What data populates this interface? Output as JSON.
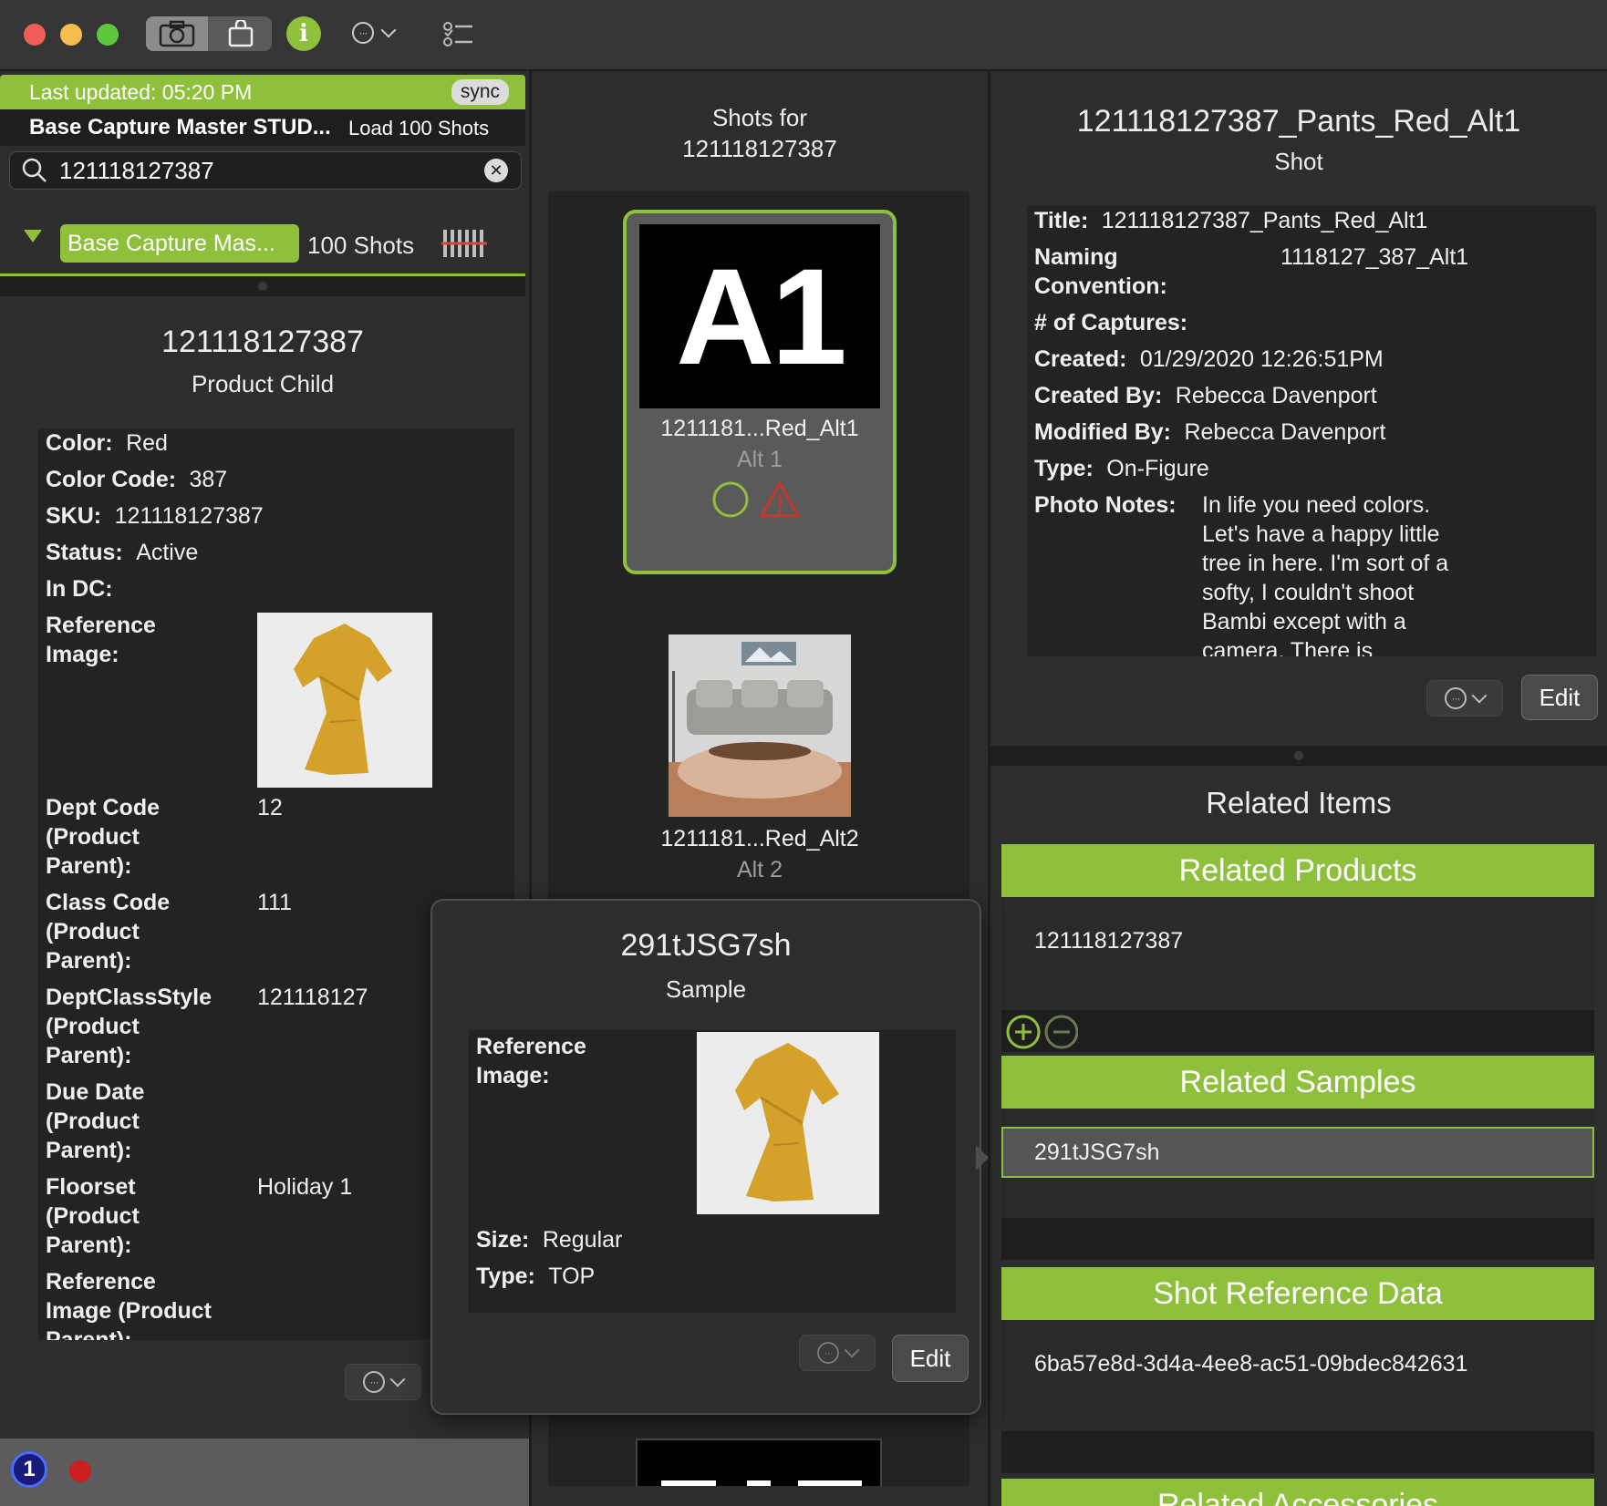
{
  "window": {
    "traffic_lights": {
      "close": "#ee5e56",
      "minimize": "#f5bd4f",
      "zoom": "#5fc73e"
    },
    "toolbar_icons": [
      "camera-icon",
      "shopping-bag-icon",
      "info-icon",
      "more-icon",
      "chevron-down-icon",
      "checklist-icon"
    ],
    "info_glyph": "i"
  },
  "colors": {
    "accent": "#8fc03c",
    "warning": "#c0392b",
    "record": "#cc1f1f"
  },
  "left": {
    "last_updated": "Last updated: 05:20 PM",
    "sync_label": "sync",
    "capture_name": "Base Capture Master STUD...",
    "load_label": "Load 100 Shots",
    "search": {
      "value": "121118127387",
      "placeholder": ""
    },
    "group": {
      "name": "Base Capture Mas...",
      "count": "100 Shots"
    },
    "title": "121118127387",
    "subtitle": "Product Child",
    "fields": {
      "color_label": "Color:",
      "color_value": "Red",
      "color_code_label": "Color Code:",
      "color_code_value": "387",
      "sku_label": "SKU:",
      "sku_value": "121118127387",
      "status_label": "Status:",
      "status_value": "Active",
      "in_dc_label": "In DC:",
      "ref_image_label_1": "Reference",
      "ref_image_label_2": "Image:",
      "dept_code_1": "Dept Code",
      "dept_code_2": "(Product",
      "dept_code_3": "Parent):",
      "dept_code_value": "12",
      "class_code_1": "Class Code",
      "class_code_2": "(Product",
      "class_code_3": "Parent):",
      "class_code_value": "111",
      "dcs_1": "DeptClassStyle",
      "dcs_2": "(Product",
      "dcs_3": "Parent):",
      "dcs_value": "121118127",
      "due_1": "Due Date",
      "due_2": "(Product",
      "due_3": "Parent):",
      "floorset_1": "Floorset",
      "floorset_2": "(Product",
      "floorset_3": "Parent):",
      "floorset_value": "Holiday 1",
      "refp_1": "Reference",
      "refp_2": "Image (Product",
      "refp_3": "Parent):"
    }
  },
  "middle": {
    "header_1": "Shots for",
    "header_2": "121118127387",
    "shots": [
      {
        "thumb_text": "A1",
        "name": "1211181...Red_Alt1",
        "alt": "Alt 1"
      },
      {
        "thumb_text": "",
        "name": "1211181...Red_Alt2",
        "alt": "Alt 2"
      }
    ]
  },
  "popover": {
    "title": "291tJSG7sh",
    "subtitle": "Sample",
    "ref_label_1": "Reference",
    "ref_label_2": "Image:",
    "size_label": "Size:",
    "size_value": "Regular",
    "type_label": "Type:",
    "type_value": "TOP",
    "edit_label": "Edit"
  },
  "right": {
    "title": "121118127387_Pants_Red_Alt1",
    "subtitle": "Shot",
    "fields": {
      "title_label": "Title:",
      "title_value": "121118127387_Pants_Red_Alt1",
      "naming_1": "Naming",
      "naming_2": "Convention:",
      "naming_value": "1118127_387_Alt1",
      "captures_label": "# of Captures:",
      "created_label": "Created:",
      "created_value": "01/29/2020 12:26:51PM",
      "created_by_label": "Created By:",
      "created_by_value": "Rebecca Davenport",
      "modified_by_label": "Modified By:",
      "modified_by_value": "Rebecca Davenport",
      "type_label": "Type:",
      "type_value": "On-Figure",
      "notes_label": "Photo Notes:",
      "notes_lines": [
        "In life you need colors.",
        "Let's have a happy little",
        "tree in here. I'm sort of a",
        "softy, I couldn't shoot",
        "Bambi except with a",
        "camera. There is"
      ]
    },
    "edit_label": "Edit",
    "related_title": "Related Items",
    "related_products_label": "Related Products",
    "related_product_value": "121118127387",
    "related_samples_label": "Related Samples",
    "related_sample_value": "291tJSG7sh",
    "shot_ref_label": "Shot Reference Data",
    "shot_ref_value": "6ba57e8d-3d4a-4ee8-ac51-09bdec842631",
    "related_accessories_label": "Related Accessories"
  }
}
